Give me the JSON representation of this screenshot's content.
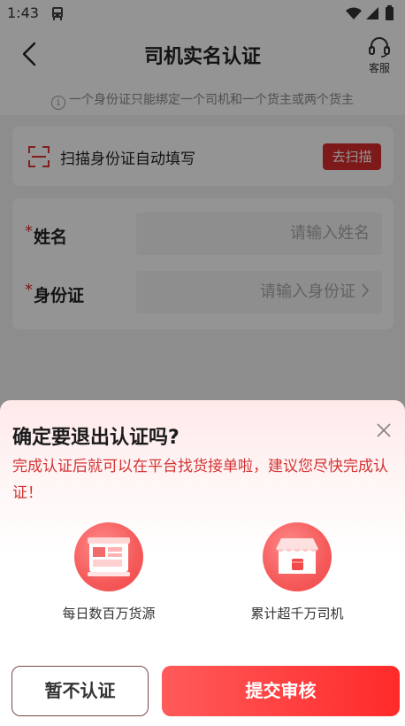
{
  "status_bar": {
    "time": "1:43"
  },
  "nav": {
    "title": "司机实名认证",
    "service_label": "客服"
  },
  "notice": {
    "text": "一个身份证只能绑定一个司机和一个货主或两个货主"
  },
  "scan": {
    "text": "扫描身份证自动填写",
    "button": "去扫描"
  },
  "form": {
    "name": {
      "required_mark": "*",
      "label": "姓名",
      "placeholder": "请输入姓名"
    },
    "id_card": {
      "required_mark": "*",
      "label": "身份证",
      "placeholder": "请输入身份证"
    }
  },
  "dialog": {
    "title": "确定要退出认证吗?",
    "description": "完成认证后就可以在平台找货接单啦，建议您尽快完成认证！",
    "features": [
      {
        "icon": "cargo-board-icon",
        "caption": "每日数百万货源"
      },
      {
        "icon": "storefront-icon",
        "caption": "累计超千万司机"
      }
    ],
    "cancel_button": "暂不认证",
    "submit_button": "提交审核"
  },
  "colors": {
    "accent": "#ff3b3b",
    "scan_button": "#d92b2b",
    "description_text": "#d43333"
  }
}
